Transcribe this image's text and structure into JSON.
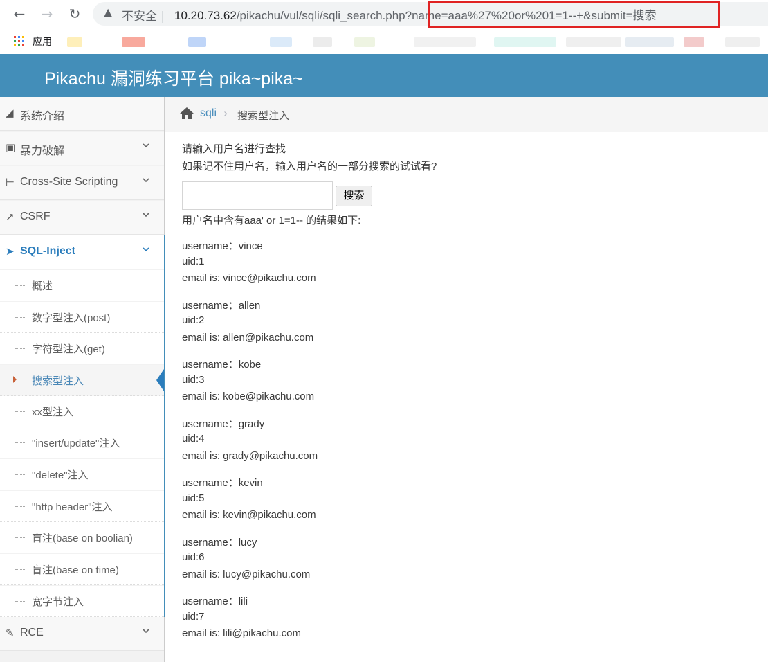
{
  "browser": {
    "insecure_label": "不安全",
    "url_host": "10.20.73.62",
    "url_path": "/pikachu/vul/sqli/sqli_search.php",
    "url_query": "?name=aaa%27%20or%201=1--+&submit=搜索",
    "apps_label": "应用"
  },
  "header": {
    "title": "Pikachu 漏洞练习平台 pika~pika~",
    "bg_color": "#438eb9"
  },
  "sidebar": {
    "items": [
      {
        "label": "系统介绍",
        "icon": "tags-icon"
      },
      {
        "label": "暴力破解",
        "icon": "lock-icon"
      },
      {
        "label": "Cross-Site Scripting",
        "icon": "sitemap-icon"
      },
      {
        "label": "CSRF",
        "icon": "share-icon"
      },
      {
        "label": "SQL-Inject",
        "icon": "plane-icon"
      },
      {
        "label": "RCE",
        "icon": "pencil-icon"
      }
    ],
    "sql_sub_items": [
      "概述",
      "数字型注入(post)",
      "字符型注入(get)",
      "搜索型注入",
      "xx型注入",
      "\"insert/update\"注入",
      "\"delete\"注入",
      "\"http header\"注入",
      "盲注(base on boolian)",
      "盲注(base on time)",
      "宽字节注入"
    ]
  },
  "breadcrumb": {
    "link": "sqli",
    "current": "搜索型注入"
  },
  "main": {
    "prompt_line1": "请输入用户名进行查找",
    "prompt_line2": "如果记不住用户名，输入用户名的一部分搜索的试试看?",
    "search_value": "",
    "search_button": "搜索",
    "result_heading": "用户名中含有aaa' or 1=1-- 的结果如下:",
    "results": [
      {
        "username": "username：vince",
        "uid": "uid:1",
        "email": "email is: vince@pikachu.com"
      },
      {
        "username": "username：allen",
        "uid": "uid:2",
        "email": "email is: allen@pikachu.com"
      },
      {
        "username": "username：kobe",
        "uid": "uid:3",
        "email": "email is: kobe@pikachu.com"
      },
      {
        "username": "username：grady",
        "uid": "uid:4",
        "email": "email is: grady@pikachu.com"
      },
      {
        "username": "username：kevin",
        "uid": "uid:5",
        "email": "email is: kevin@pikachu.com"
      },
      {
        "username": "username：lucy",
        "uid": "uid:6",
        "email": "email is: lucy@pikachu.com"
      },
      {
        "username": "username：lili",
        "uid": "uid:7",
        "email": "email is: lili@pikachu.com"
      }
    ]
  }
}
